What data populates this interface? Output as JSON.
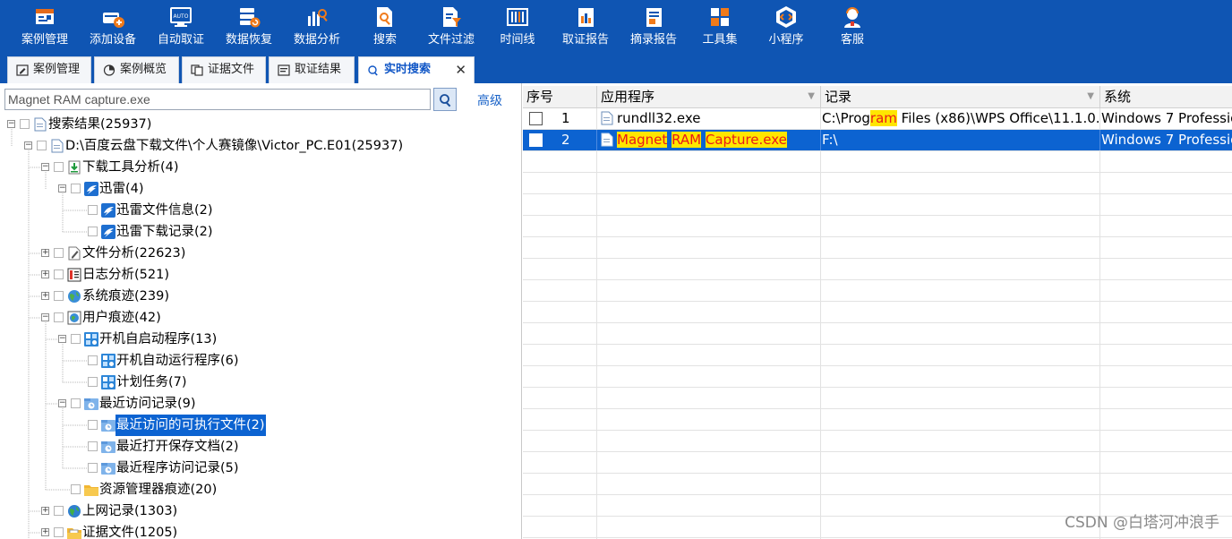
{
  "toolbar": {
    "buttons": [
      {
        "label": "案例管理",
        "icon": "case-management-icon"
      },
      {
        "label": "添加设备",
        "icon": "add-device-icon"
      },
      {
        "label": "自动取证",
        "icon": "auto-forensics-icon"
      },
      {
        "label": "数据恢复",
        "icon": "data-recovery-icon"
      },
      {
        "label": "数据分析",
        "icon": "data-analysis-icon"
      },
      {
        "label": "搜索",
        "icon": "search-icon"
      },
      {
        "label": "文件过滤",
        "icon": "file-filter-icon"
      },
      {
        "label": "时间线",
        "icon": "timeline-icon"
      },
      {
        "label": "取证报告",
        "icon": "forensics-report-icon"
      },
      {
        "label": "摘录报告",
        "icon": "excerpt-report-icon"
      },
      {
        "label": "工具集",
        "icon": "toolset-icon"
      },
      {
        "label": "小程序",
        "icon": "mini-program-icon"
      },
      {
        "label": "客服",
        "icon": "customer-service-icon"
      }
    ],
    "icon_auto_text": "AUTO"
  },
  "tabs": [
    {
      "label": "案例管理",
      "icon": "case-icon",
      "active": false
    },
    {
      "label": "案例概览",
      "icon": "overview-icon",
      "active": false
    },
    {
      "label": "证据文件",
      "icon": "evidence-file-icon",
      "active": false
    },
    {
      "label": "取证结果",
      "icon": "results-icon",
      "active": false
    },
    {
      "label": "实时搜索",
      "icon": "live-search-icon",
      "active": true
    }
  ],
  "tab_close": "✕",
  "search": {
    "value": "Magnet RAM capture.exe",
    "advanced_label": "高级"
  },
  "tree": {
    "nodes": [
      {
        "label": "搜索结果(25937)",
        "icon": "document-icon"
      },
      {
        "label": "D:\\百度云盘下载文件\\个人赛镜像\\Victor_PC.E01(25937)",
        "icon": "document-icon"
      },
      {
        "label": "下载工具分析(4)",
        "icon": "download-icon"
      },
      {
        "label": "迅雷(4)",
        "icon": "thunder-icon"
      },
      {
        "label": "迅雷文件信息(2)",
        "icon": "thunder-icon"
      },
      {
        "label": "迅雷下载记录(2)",
        "icon": "thunder-icon"
      },
      {
        "label": "文件分析(22623)",
        "icon": "file-analysis-icon"
      },
      {
        "label": "日志分析(521)",
        "icon": "log-icon"
      },
      {
        "label": "系统痕迹(239)",
        "icon": "system-trace-icon"
      },
      {
        "label": "用户痕迹(42)",
        "icon": "user-trace-icon"
      },
      {
        "label": "开机自启动程序(13)",
        "icon": "startup-icon"
      },
      {
        "label": "开机自动运行程序(6)",
        "icon": "startup-icon"
      },
      {
        "label": "计划任务(7)",
        "icon": "startup-icon"
      },
      {
        "label": "最近访问记录(9)",
        "icon": "recent-icon"
      },
      {
        "label": "最近访问的可执行文件(2)",
        "icon": "recent-icon",
        "selected": true
      },
      {
        "label": "最近打开保存文档(2)",
        "icon": "recent-icon"
      },
      {
        "label": "最近程序访问记录(5)",
        "icon": "recent-icon"
      },
      {
        "label": "资源管理器痕迹(20)",
        "icon": "folder-icon"
      },
      {
        "label": "上网记录(1303)",
        "icon": "globe-icon"
      },
      {
        "label": "证据文件(1205)",
        "icon": "evidence-folder-icon"
      }
    ]
  },
  "grid": {
    "headers": [
      "序号",
      "应用程序",
      "记录",
      "系统"
    ],
    "rows": [
      {
        "index": "1",
        "app": "rundll32.exe",
        "record_pre": "C:\\Prog",
        "record_hl": "ram",
        "record_post": " Files (x86)\\WPS Office\\11.1.0...",
        "system": "Windows 7 Professio"
      },
      {
        "index": "2",
        "app_parts": [
          "Magnet",
          "RAM",
          "Capture.exe"
        ],
        "record": "F:\\",
        "system": "Windows 7 Professio",
        "selected": true
      }
    ]
  },
  "watermark": "CSDN @白塔河冲浪手",
  "colors": {
    "toolbar_bg": "#0f55b3",
    "selection": "#0c63d1",
    "highlight_bg": "#ffe600",
    "highlight_fg": "#e81a1a",
    "active_tab_text": "#1056c6"
  }
}
